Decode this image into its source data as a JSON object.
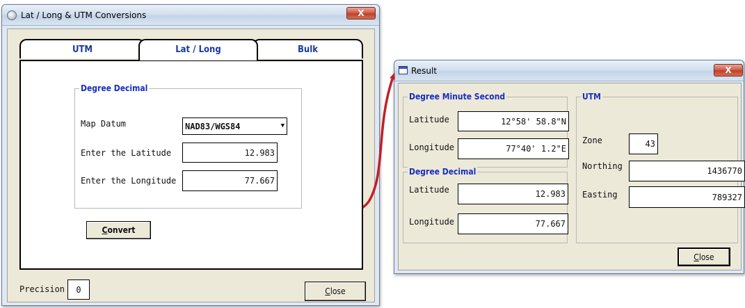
{
  "main_window": {
    "title": "Lat / Long & UTM Conversions",
    "close_glyph": "X",
    "tabs": [
      {
        "label": "UTM"
      },
      {
        "label": "Lat / Long"
      },
      {
        "label": "Bulk"
      }
    ],
    "group_title": "Degree Decimal",
    "map_datum_label": "Map Datum",
    "map_datum_value": "NAD83/WGS84",
    "latitude_label": "Enter the Latitude",
    "latitude_value": "12.983",
    "longitude_label": "Enter the Longitude",
    "longitude_value": "77.667",
    "convert_button": {
      "mnemonic": "C",
      "rest": "onvert"
    },
    "precision_label": "Precision",
    "precision_value": "0",
    "close_button": {
      "mnemonic": "C",
      "rest": "lose"
    }
  },
  "result_window": {
    "title": "Result",
    "close_glyph": "X",
    "dms_group": {
      "title": "Degree Minute Second",
      "latitude_label": "Latitude",
      "latitude_value": "12°58' 58.8\"N",
      "longitude_label": "Longitude",
      "longitude_value": "77°40' 1.2\"E"
    },
    "dd_group": {
      "title": "Degree Decimal",
      "latitude_label": "Latitude",
      "latitude_value": "12.983",
      "longitude_label": "Longitude",
      "longitude_value": "77.667"
    },
    "utm_group": {
      "title": "UTM",
      "zone_label": "Zone",
      "zone_value": "43",
      "northing_label": "Northing",
      "northing_value": "1436770",
      "easting_label": "Easting",
      "easting_value": "789327"
    },
    "close_button": {
      "mnemonic": "C",
      "rest": "lose"
    }
  },
  "annotation": {
    "highlight_color": "#c0202a"
  }
}
